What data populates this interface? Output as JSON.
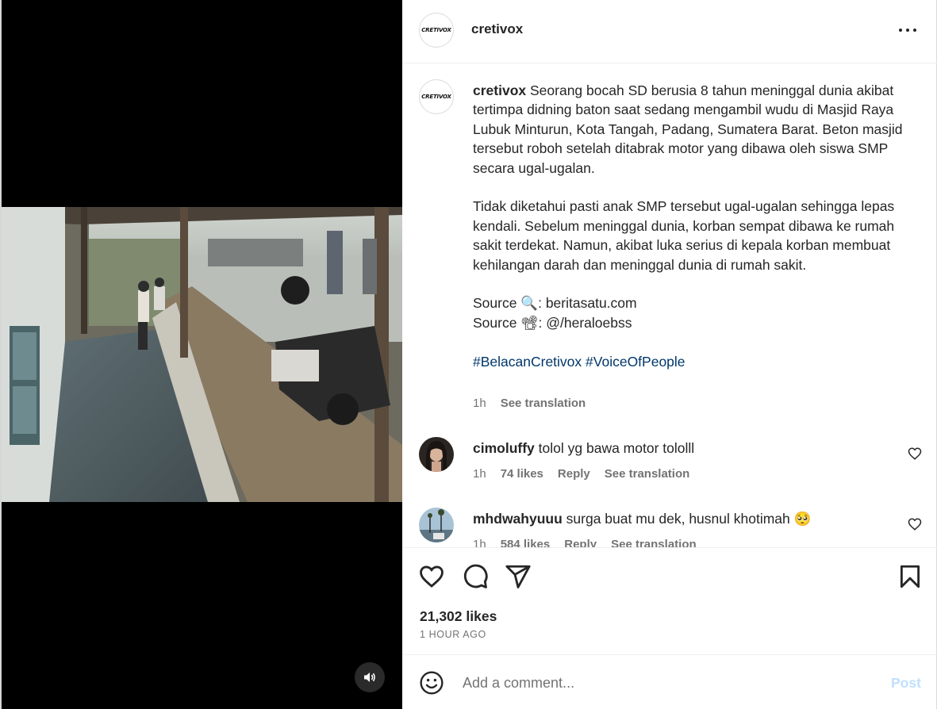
{
  "post": {
    "username": "cretivox",
    "avatar_text": "CRETIVOX"
  },
  "caption": {
    "username": "cretivox",
    "paragraph1": "Seorang bocah SD berusia 8 tahun meninggal dunia akibat tertimpa didning baton saat sedang mengambil wudu di Masjid Raya Lubuk Minturun, Kota Tangah, Padang, Sumatera Barat. Beton masjid tersebut roboh setelah ditabrak motor yang dibawa oleh siswa SMP secara ugal-ugalan.",
    "paragraph2": "Tidak diketahui pasti anak SMP tersebut ugal-ugalan sehingga lepas kendali. Sebelum meninggal dunia, korban sempat dibawa ke rumah sakit terdekat. Namun, akibat luka serius di kepala korban membuat kehilangan darah dan meninggal dunia di rumah sakit.",
    "source1": "Source 🔍: beritasatu.com",
    "source2": "Source 📽: @/heraloebss",
    "hashtags": [
      "#BelacanCretivox",
      "#VoiceOfPeople"
    ],
    "time": "1h",
    "see_translation": "See translation"
  },
  "comments": [
    {
      "username": "cimoluffy",
      "text": "tolol yg bawa motor tololll",
      "time": "1h",
      "likes": "74 likes",
      "reply": "Reply",
      "see_translation": "See translation"
    },
    {
      "username": "mhdwahyuuu",
      "text": "surga buat mu dek, husnul khotimah 🥺",
      "time": "1h",
      "likes": "584 likes",
      "reply": "Reply",
      "see_translation": "See translation"
    }
  ],
  "actions": {
    "likes": "21,302 likes",
    "time_ago": "1 HOUR AGO"
  },
  "add_comment": {
    "placeholder": "Add a comment...",
    "post_label": "Post"
  },
  "icons": {
    "more": "more-options-icon",
    "like": "heart-icon",
    "comment": "comment-icon",
    "share": "send-icon",
    "save": "bookmark-icon",
    "emoji": "emoji-icon",
    "volume": "volume-icon"
  },
  "colors": {
    "hashtag": "#00376b",
    "muted": "#737373",
    "post_disabled": "#c0dffd"
  }
}
